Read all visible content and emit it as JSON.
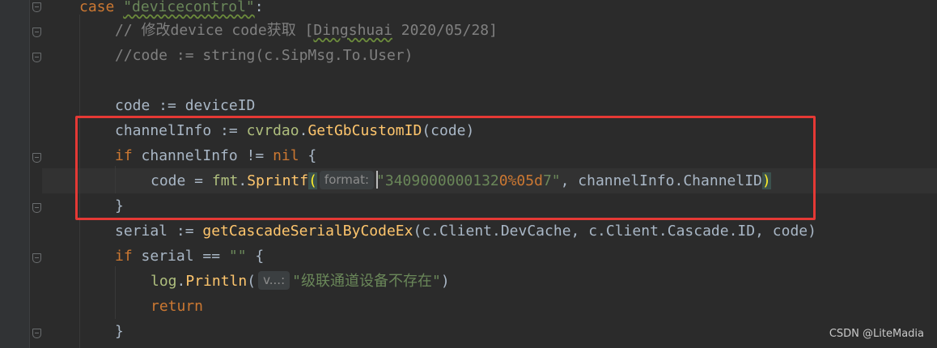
{
  "editor": {
    "lines": [
      {
        "segments": [
          {
            "t": "case ",
            "c": "kw"
          },
          {
            "t": "\"devicecontrol\"",
            "c": "str squig"
          },
          {
            "t": ":",
            "c": ""
          }
        ]
      },
      {
        "segments": [
          {
            "t": "// 修改device code获取 [",
            "c": "cmt"
          },
          {
            "t": "Dingshuai",
            "c": "cmt squig"
          },
          {
            "t": " 2020/05/28]",
            "c": "cmt"
          }
        ]
      },
      {
        "segments": [
          {
            "t": "//code := string(c.SipMsg.To.User)",
            "c": "cmt"
          }
        ]
      },
      {
        "segments": []
      },
      {
        "segments": [
          {
            "t": "code := deviceID",
            "c": ""
          }
        ]
      },
      {
        "segments": [
          {
            "t": "channelInfo := ",
            "c": ""
          },
          {
            "t": "cvrdao",
            "c": "pkg"
          },
          {
            "t": ".",
            "c": ""
          },
          {
            "t": "GetGbCustomID",
            "c": "fn"
          },
          {
            "t": "(code)",
            "c": ""
          }
        ]
      },
      {
        "segments": [
          {
            "t": "if ",
            "c": "kw"
          },
          {
            "t": "channelInfo != ",
            "c": ""
          },
          {
            "t": "nil",
            "c": "kw"
          },
          {
            "t": " {",
            "c": ""
          }
        ]
      },
      {
        "segments": [
          {
            "t": "code = ",
            "c": ""
          },
          {
            "t": "fmt",
            "c": "pkg"
          },
          {
            "t": ".",
            "c": ""
          },
          {
            "t": "Sprintf",
            "c": "fn"
          },
          {
            "t": "(",
            "c": "brace-match"
          },
          {
            "hint": "format:"
          },
          {
            "caret": true
          },
          {
            "t": "\"3409000000132",
            "c": "str"
          },
          {
            "t": "0%05d",
            "c": "fmt"
          },
          {
            "t": "7\"",
            "c": "str"
          },
          {
            "t": ", channelInfo.ChannelID",
            "c": ""
          },
          {
            "t": ")",
            "c": "brace-match"
          }
        ]
      },
      {
        "segments": [
          {
            "t": "}",
            "c": ""
          }
        ]
      },
      {
        "segments": [
          {
            "t": "serial := ",
            "c": ""
          },
          {
            "t": "getCascadeSerialByCodeEx",
            "c": "fn"
          },
          {
            "t": "(c.Client.DevCache, c.Client.Cascade.ID, code)",
            "c": ""
          }
        ]
      },
      {
        "segments": [
          {
            "t": "if ",
            "c": "kw"
          },
          {
            "t": "serial == ",
            "c": ""
          },
          {
            "t": "\"\"",
            "c": "str"
          },
          {
            "t": " {",
            "c": ""
          }
        ]
      },
      {
        "segments": [
          {
            "t": "log",
            "c": "pkg"
          },
          {
            "t": ".",
            "c": ""
          },
          {
            "t": "Println",
            "c": "fn"
          },
          {
            "t": "(",
            "c": ""
          },
          {
            "hint": "v...:"
          },
          {
            "t": "\"级联通道设备不存在\"",
            "c": "str"
          },
          {
            "t": ")",
            "c": ""
          }
        ]
      },
      {
        "segments": [
          {
            "t": "return",
            "c": "kw"
          }
        ]
      },
      {
        "segments": [
          {
            "t": "}",
            "c": ""
          }
        ]
      }
    ]
  },
  "watermark": "CSDN @LiteMadia"
}
